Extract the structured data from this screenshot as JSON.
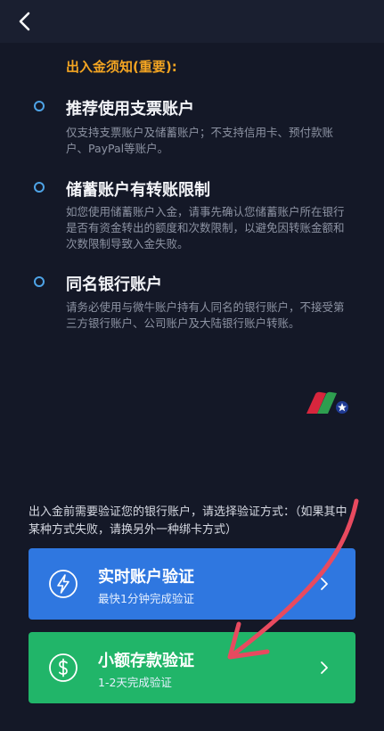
{
  "notice": {
    "title": "出入金须知(重要):"
  },
  "sections": [
    {
      "heading": "推荐使用支票账户",
      "body": "仅支持支票账户及储蓄账户；不支持信用卡、预付款账户、PayPal等账户。"
    },
    {
      "heading": "储蓄账户有转账限制",
      "body": "如您使用储蓄账户入金，请事先确认您储蓄账户所在银行是否有资金转出的额度和次数限制，以避免因转账金额和次数限制导致入金失败。"
    },
    {
      "heading": "同名银行账户",
      "body": "请务必使用与微牛账户持有人同名的银行账户，不接受第三方银行账户、公司账户及大陆银行账户转账。"
    }
  ],
  "verify": {
    "hint": "出入金前需要验证您的银行账户，请选择验证方式：（如果其中某种方式失败，请换另外一种绑卡方式）",
    "options": [
      {
        "title": "实时账户验证",
        "subtitle": "最快1分钟完成验证",
        "icon": "lightning-icon",
        "color": "#2f77e0"
      },
      {
        "title": "小额存款验证",
        "subtitle": "1-2天完成验证",
        "icon": "dollar-icon",
        "color": "#21b569"
      }
    ]
  },
  "colors": {
    "background": "#141827",
    "accent_orange": "#f4a522",
    "bullet_blue": "#4ea3e6",
    "annotation_arrow": "#e84a5f"
  }
}
